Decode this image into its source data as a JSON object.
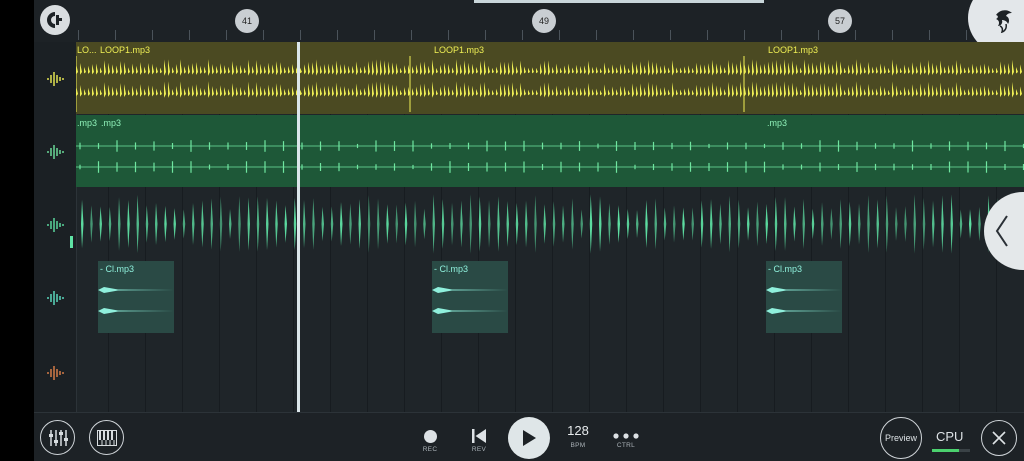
{
  "timeline": {
    "markers": [
      "41",
      "49",
      "57"
    ]
  },
  "tracks": [
    {
      "color": "#f0f055",
      "bg": "#4f4e24",
      "clips": [
        {
          "label": "LO..."
        },
        {
          "label": "LOOP1.mp3"
        },
        {
          "label": "LOOP1.mp3"
        },
        {
          "label": "LOOP1.mp3"
        }
      ]
    },
    {
      "color": "#6fe6a0",
      "bg": "#1f5a3a",
      "clips": [
        {
          "label": ".mp3"
        },
        {
          "label": ".mp3"
        },
        {
          "label": ".mp3"
        }
      ]
    },
    {
      "color": "#5fe3a5",
      "bg": "#1f2529",
      "clips": []
    },
    {
      "color": "#5fe3c6",
      "bg": "#2a4a45",
      "clips": [
        {
          "label": "- Cl.mp3"
        },
        {
          "label": "- Cl.mp3"
        },
        {
          "label": "- Cl.mp3"
        }
      ]
    },
    {
      "color": "#e0814a",
      "bg": "#1f2529",
      "clips": []
    }
  ],
  "bottombar": {
    "rec_label": "REC",
    "rev_label": "REV",
    "bpm_value": "128",
    "bpm_label": "BPM",
    "ctrl_label": "CTRL",
    "preview_label": "Preview",
    "cpu_label": "CPU"
  },
  "icons": {
    "logo": "fl-c-icon",
    "mixer": "mixer-icon",
    "piano": "piano-icon",
    "play": "play-icon",
    "close": "close-icon",
    "collapse": "chevron-left-icon"
  }
}
